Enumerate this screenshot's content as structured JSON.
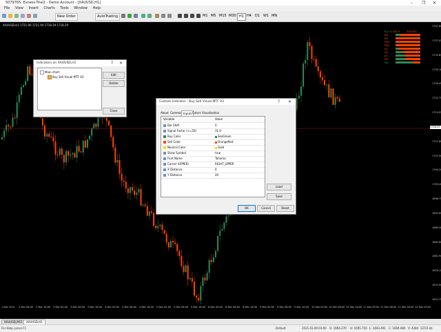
{
  "window": {
    "title": "5079765: Exness-Trial2 - Demo Account - [XAUUSD,H1]",
    "controls": [
      "–",
      "❐",
      "✕"
    ]
  },
  "menu": [
    "File",
    "View",
    "Insert",
    "Charts",
    "Tools",
    "Window",
    "Help"
  ],
  "toolbar": {
    "new_order": "New Order",
    "auto_trading": "AutoTrading",
    "timeframes": [
      "M1",
      "M5",
      "M15",
      "M30",
      "H1",
      "H4",
      "D1",
      "W1",
      "MN"
    ]
  },
  "chart": {
    "symbol_label": "XAUUSD,H1 1721.90 1721.90 1718.29 1718.29",
    "current_price": "1718.29",
    "y_ticks": [
      "1741.80",
      "1737.05",
      "1733.85",
      "1730.18",
      "1726.45",
      "1722.75",
      "1719.05",
      "1715.30",
      "1711.60",
      "1707.90",
      "1704.20",
      "1700.40",
      "1696.75",
      "1693.00",
      "1689.30",
      "1685.60",
      "1681.90",
      "1678.15",
      "1674.50",
      "1670.75"
    ],
    "x_ticks": [
      "1 Mar 2021",
      "2 Mar 08:00",
      "2 Mar 16:00",
      "3 Mar 00:00",
      "3 Mar 08:00",
      "3 Mar 16:00",
      "4 Mar 00:00",
      "4 Mar 08:00",
      "4 Mar 16:00",
      "5 Mar 00:00",
      "5 Mar 08:00",
      "5 Mar 16:00",
      "8 Mar 00:00",
      "8 Mar 08:00",
      "8 Mar 16:00",
      "9 Mar 00:00",
      "9 Mar 08:00",
      "9 Mar 16:00",
      "10 Mar 00:00",
      "10 Mar 08:00",
      "10 Mar 16:00",
      "11 Mar 00:00",
      "11 Mar 08:00",
      "11 Mar 16:00",
      "12 Mar 00:00"
    ]
  },
  "mtf_panel": {
    "header": [
      "Buy %",
      "Sell %",
      "XAUUSD"
    ],
    "rows": [
      {
        "tf": "M1",
        "buy": 20,
        "sell": 80
      },
      {
        "tf": "M5",
        "buy": 0,
        "sell": 100
      },
      {
        "tf": "M15",
        "buy": 0,
        "sell": 100
      },
      {
        "tf": "M30",
        "buy": 0,
        "sell": 100
      },
      {
        "tf": "H1",
        "buy": 10,
        "sell": 90
      },
      {
        "tf": "H4",
        "buy": 30,
        "sell": 70
      },
      {
        "tf": "D1",
        "buy": 40,
        "sell": 60
      },
      {
        "tf": "W1",
        "buy": 40,
        "sell": 60
      },
      {
        "tf": "MN",
        "buy": 70,
        "sell": 30
      }
    ]
  },
  "indicators_dialog": {
    "title": "Indicators on XAUUSD,H1",
    "tree_root": "Main chart",
    "tree_child": "Buy Sell Visual MTF V2",
    "edit": "Edit",
    "delete": "Delete",
    "close": "Close"
  },
  "custom_dialog": {
    "title": "Custom Indicator - Buy Sell Visual MTF V2",
    "tabs": [
      "About",
      "Common",
      "Inputs",
      "Colors",
      "Visualization"
    ],
    "active_tab": "Inputs",
    "col_variable": "Variable",
    "col_value": "Value",
    "rows": [
      {
        "name": "Bar Shift",
        "value": "0"
      },
      {
        "name": "Signal Factor (<=50)",
        "value": "31.0"
      },
      {
        "name": "Buy Color",
        "value": "SeaGreen",
        "color": "#2e8b57"
      },
      {
        "name": "Sell Color",
        "value": "OrangeRed",
        "color": "#ff4500"
      },
      {
        "name": "Neutral Color",
        "value": "Gold",
        "color": "#ffd700"
      },
      {
        "name": "Show Symbol",
        "value": "true"
      },
      {
        "name": "Font Name",
        "value": "Tahoma"
      },
      {
        "name": "Corner (UPPER)",
        "value": "RIGHT_UPPER"
      },
      {
        "name": "X Distance",
        "value": "0"
      },
      {
        "name": "Y Distance",
        "value": "20"
      }
    ],
    "load": "Load",
    "save": "Save",
    "ok": "OK",
    "cancel": "Cancel",
    "reset": "Reset"
  },
  "tabs": [
    "XAUUSD,M15",
    "XAUUSD,H1"
  ],
  "status": {
    "help": "For Help, press F1",
    "profile": "Default",
    "time": "2021.03.09 03:00",
    "open": "O: 1694.270",
    "high": "H: 1695.750",
    "low": "L: 1693.491",
    "close": "C: 1694.080",
    "volume": "V: 4284",
    "traffic": "327/2 kb"
  },
  "colors": {
    "bull": "#2e8b57",
    "bear": "#ff4500",
    "neutral": "#ffd700",
    "price_line": "#b22222"
  }
}
